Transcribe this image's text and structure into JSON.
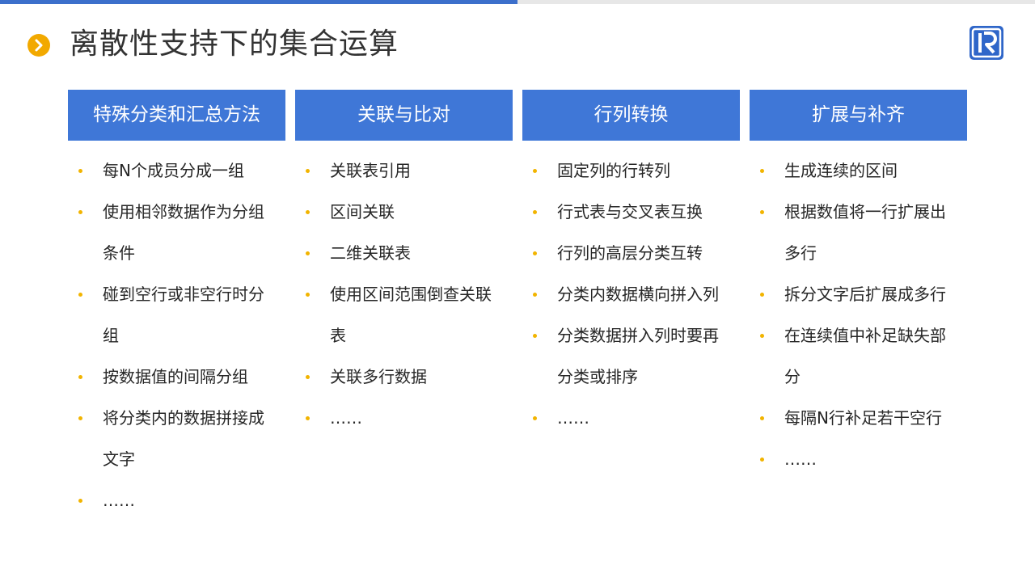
{
  "page": {
    "title": "离散性支持下的集合运算"
  },
  "colors": {
    "accent_blue": "#3f77d7",
    "bullet_yellow": "#f2b400",
    "title_marker": "#f2a900",
    "logo_blue": "#2f66c9"
  },
  "icons": {
    "title_marker": "chevron-right-circle-icon",
    "logo": "r-logo-icon"
  },
  "columns": [
    {
      "header": "特殊分类和汇总方法",
      "items": [
        "每N个成员分成一组",
        "使用相邻数据作为分组条件",
        "碰到空行或非空行时分组",
        "按数据值的间隔分组",
        "将分类内的数据拼接成文字",
        "……"
      ]
    },
    {
      "header": "关联与比对",
      "items": [
        "关联表引用",
        "区间关联",
        "二维关联表",
        "使用区间范围倒查关联表",
        "关联多行数据",
        "……"
      ]
    },
    {
      "header": "行列转换",
      "items": [
        "固定列的行转列",
        "行式表与交叉表互换",
        "行列的高层分类互转",
        "分类内数据横向拼入列",
        "分类数据拼入列时要再分类或排序",
        "……"
      ]
    },
    {
      "header": "扩展与补齐",
      "items": [
        "生成连续的区间",
        "根据数值将一行扩展出多行",
        "拆分文字后扩展成多行",
        "在连续值中补足缺失部分",
        "每隔N行补足若干空行",
        "……"
      ]
    }
  ]
}
